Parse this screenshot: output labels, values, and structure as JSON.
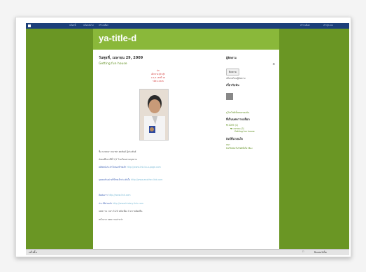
{
  "navbar": {
    "items": [
      "บล็อกนี้",
      "บล็อกถัดไป",
      "สร้างบล็อก",
      "เข้าสู่ระบบ"
    ],
    "right_items": [
      "สร้างบล็อก",
      "เข้าสู่ระบบ"
    ]
  },
  "blog": {
    "title": "ya-title-d"
  },
  "post": {
    "date": "วันพุธที่, เมษายน 29, 2009",
    "title": "Getting fun house",
    "red_lines": [
      "ปก",
      "เด็กชาย ตุ๊ก ตุ๊ก",
      "ม.1/1 เลขที่ 16",
      "รหัส 12345"
    ],
    "paragraphs": [
      {
        "label": "",
        "text": "ชื่อ นายธนา ธนาพร สุขสันต์ ผู้ประพันธ์"
      },
      {
        "label": "",
        "text": "มัธยมศึกษาปีที่ 1/1 โรงเรียนสวนกุหลาบ"
      },
      {
        "label": "คติพจน์ประจำใจของข้าพเจ้า",
        "text": "http://www.link-to-a-page.com"
      },
      {
        "label": "บุคคลตัวอย่างที่ข้าพเจ้าประทับใจ",
        "text": "http://www.another-link.com"
      },
      {
        "label": "ติดต่อเรา",
        "text": "http://www.link.com"
      },
      {
        "label": "ประวัติส่วนตัว",
        "text": "http://www.history-link.com"
      },
      {
        "label": "",
        "text": "บทความ เวลา 5:20 หลังเที่ยง 0 ความคิดเห็น"
      },
      {
        "label": "",
        "text": "หน้าแรก บทความเก่ากว่า"
      }
    ]
  },
  "sidebar": {
    "followers_heading": "ผู้ติดตาม",
    "follow_button": "ติดตาม",
    "follow_sub": "บล็อกพร้อมผู้ติดตาม",
    "about_heading": "เกี่ยวกับฉัน",
    "profile_link": "ดูโปรไฟล์ทั้งหมดของฉัน",
    "archive_heading": "ที่เก็บบทความบล็อก",
    "archive_year": "2009 (1)",
    "archive_month": "เมษายน (1)",
    "archive_post": "Getting fun house",
    "links_heading": "ลิงก์ที่น่าสนใจ",
    "link1": "ธนา",
    "link2": "ลิงก์ไปยังเว็บไซต์ที่เกี่ยวข้อง"
  },
  "statusbar": {
    "left": "เสร็จสิ้น",
    "right": "อินเทอร์เน็ต"
  },
  "colors": {
    "page_bg": "#6f9a26",
    "header": "#8ab83a",
    "navbar": "#1c3f7a",
    "link": "#5f8f1f"
  }
}
